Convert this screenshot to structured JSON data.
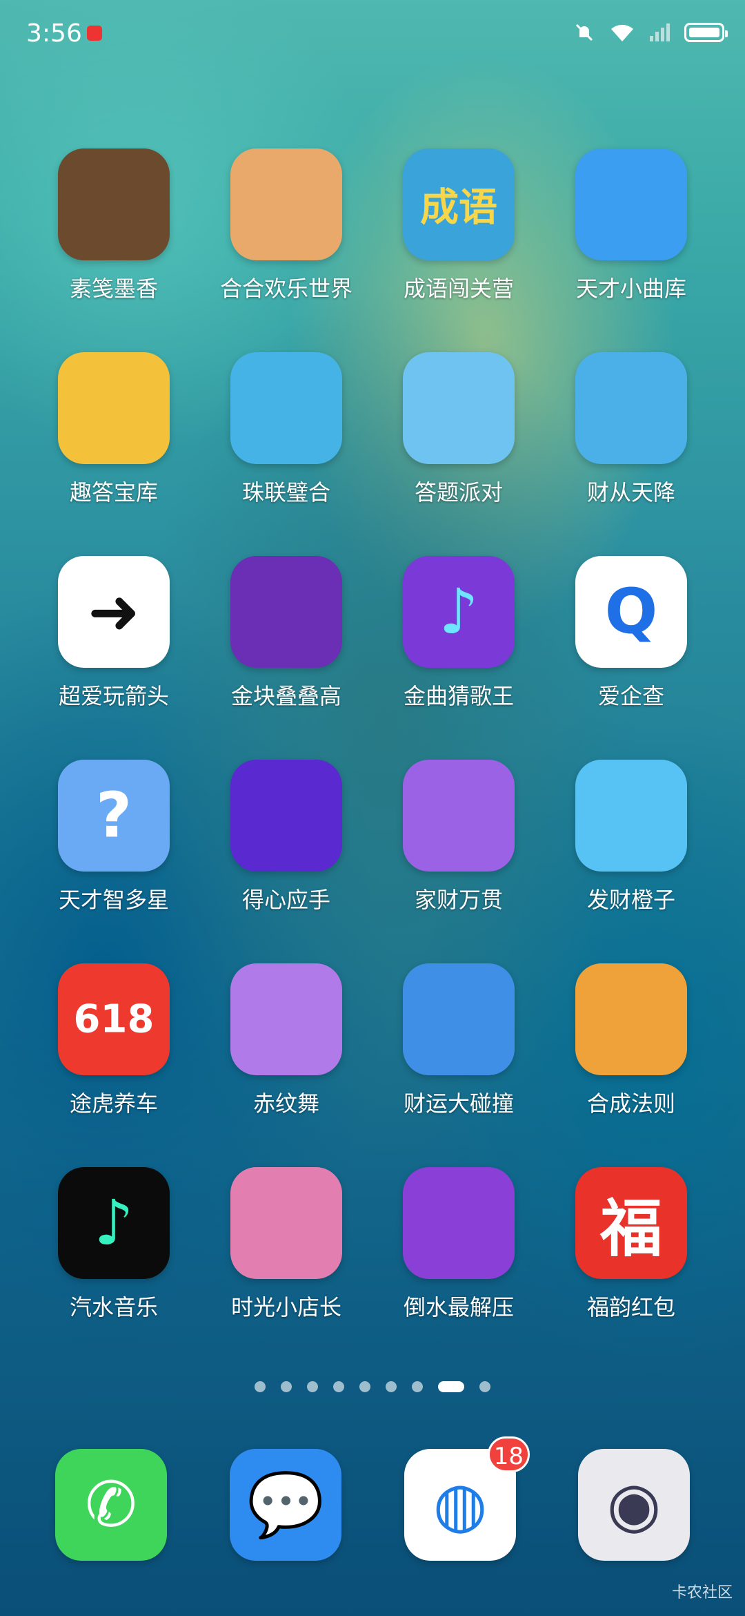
{
  "status_bar": {
    "time": "3:56"
  },
  "apps": [
    {
      "label": "素笺墨香",
      "bg": "#6b4a2e",
      "glyph": "",
      "fg": "#fff"
    },
    {
      "label": "合合欢乐世界",
      "bg": "#e9a96a",
      "glyph": "",
      "fg": "#fff"
    },
    {
      "label": "成语闯关营",
      "bg": "#3aa3d9",
      "glyph": "成语",
      "fg": "#f7d64a"
    },
    {
      "label": "天才小曲库",
      "bg": "#3b9ef0",
      "glyph": "",
      "fg": "#fff"
    },
    {
      "label": "趣答宝库",
      "bg": "#f3c13a",
      "glyph": "",
      "fg": "#fff"
    },
    {
      "label": "珠联璧合",
      "bg": "#46b3e6",
      "glyph": "",
      "fg": "#fff"
    },
    {
      "label": "答题派对",
      "bg": "#6fc3f0",
      "glyph": "",
      "fg": "#fff"
    },
    {
      "label": "财从天降",
      "bg": "#4bb0e8",
      "glyph": "",
      "fg": "#fff"
    },
    {
      "label": "超爱玩箭头",
      "bg": "#ffffff",
      "glyph": "➜",
      "fg": "#111"
    },
    {
      "label": "金块叠叠高",
      "bg": "#6a2fb4",
      "glyph": "",
      "fg": "#fff"
    },
    {
      "label": "金曲猜歌王",
      "bg": "#7b3ad8",
      "glyph": "♪",
      "fg": "#6ee6ff"
    },
    {
      "label": "爱企查",
      "bg": "#ffffff",
      "glyph": "Q",
      "fg": "#1f6fe6"
    },
    {
      "label": "天才智多星",
      "bg": "#6aa9f3",
      "glyph": "?",
      "fg": "#fff"
    },
    {
      "label": "得心应手",
      "bg": "#5a2ad0",
      "glyph": "",
      "fg": "#fff"
    },
    {
      "label": "家财万贯",
      "bg": "#9b62e6",
      "glyph": "",
      "fg": "#fff"
    },
    {
      "label": "发财橙子",
      "bg": "#57c3f5",
      "glyph": "",
      "fg": "#fff"
    },
    {
      "label": "途虎养车",
      "bg": "#ee3a2e",
      "glyph": "618",
      "fg": "#fff"
    },
    {
      "label": "赤纹舞",
      "bg": "#b07ae8",
      "glyph": "",
      "fg": "#fff"
    },
    {
      "label": "财运大碰撞",
      "bg": "#3f8fe6",
      "glyph": "",
      "fg": "#fff"
    },
    {
      "label": "合成法则",
      "bg": "#f0a23a",
      "glyph": "",
      "fg": "#fff"
    },
    {
      "label": "汽水音乐",
      "bg": "#0b0b0b",
      "glyph": "♪",
      "fg": "#36f0c0"
    },
    {
      "label": "时光小店长",
      "bg": "#e37fb0",
      "glyph": "",
      "fg": "#fff"
    },
    {
      "label": "倒水最解压",
      "bg": "#8a3fd6",
      "glyph": "",
      "fg": "#fff"
    },
    {
      "label": "福韵红包",
      "bg": "#e8322a",
      "glyph": "福",
      "fg": "#fff"
    }
  ],
  "page_indicator": {
    "total": 9,
    "active": 8
  },
  "dock": [
    {
      "name": "phone",
      "bg": "#3ed55a",
      "glyph": "✆",
      "fg": "#fff"
    },
    {
      "name": "messages",
      "bg": "#2e8cf0",
      "glyph": "💬",
      "fg": "#fff"
    },
    {
      "name": "browser",
      "bg": "#ffffff",
      "glyph": "◍",
      "fg": "#1f7de8",
      "badge": "18"
    },
    {
      "name": "camera",
      "bg": "#e9e9ee",
      "glyph": "◉",
      "fg": "#3a3a55"
    }
  ],
  "watermark": "卡农社区"
}
